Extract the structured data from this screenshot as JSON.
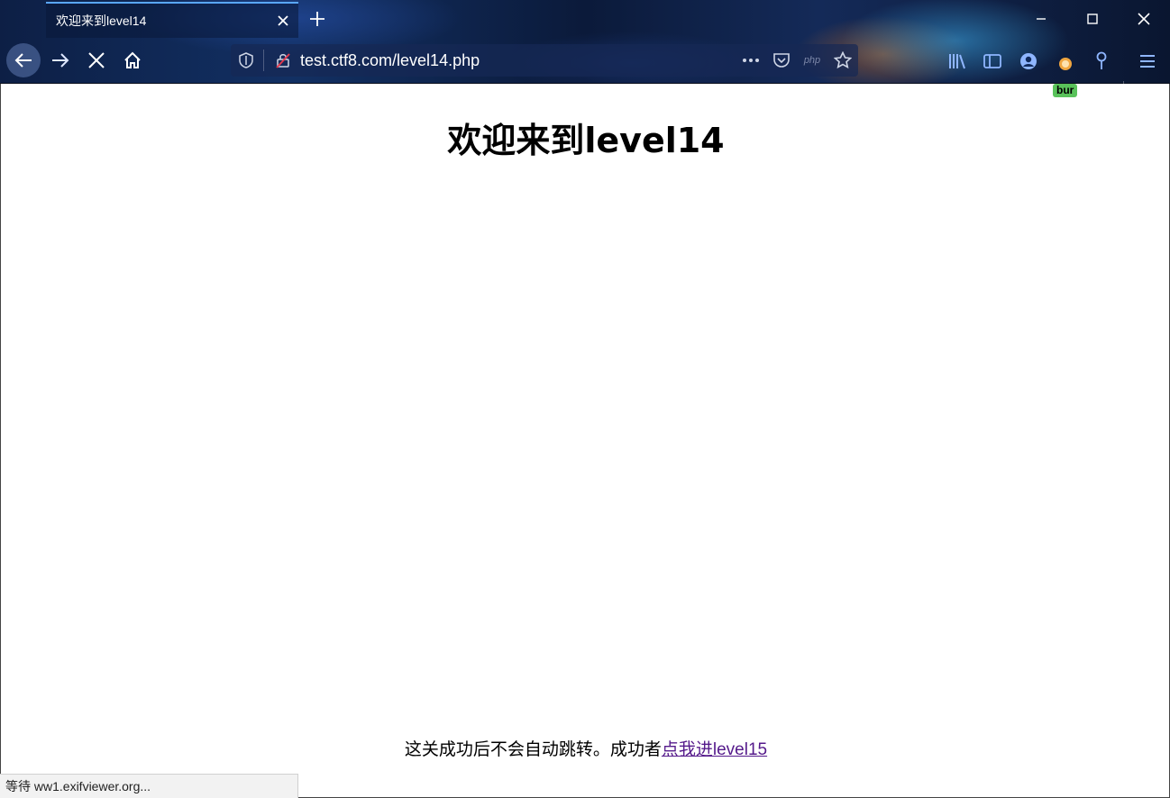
{
  "browser": {
    "tab_title": "欢迎来到level14",
    "url": "test.ctf8.com/level14.php",
    "php_badge": "php",
    "extension_badge": "bur",
    "status_text": "等待 ww1.exifviewer.org..."
  },
  "page": {
    "heading": "欢迎来到level14",
    "footer_text": "这关成功后不会自动跳转。成功者",
    "link_text": "点我进level15"
  },
  "colors": {
    "link_visited": "#551a8b",
    "tab_accent": "#59a7ff",
    "badge_green": "#59c25a"
  }
}
